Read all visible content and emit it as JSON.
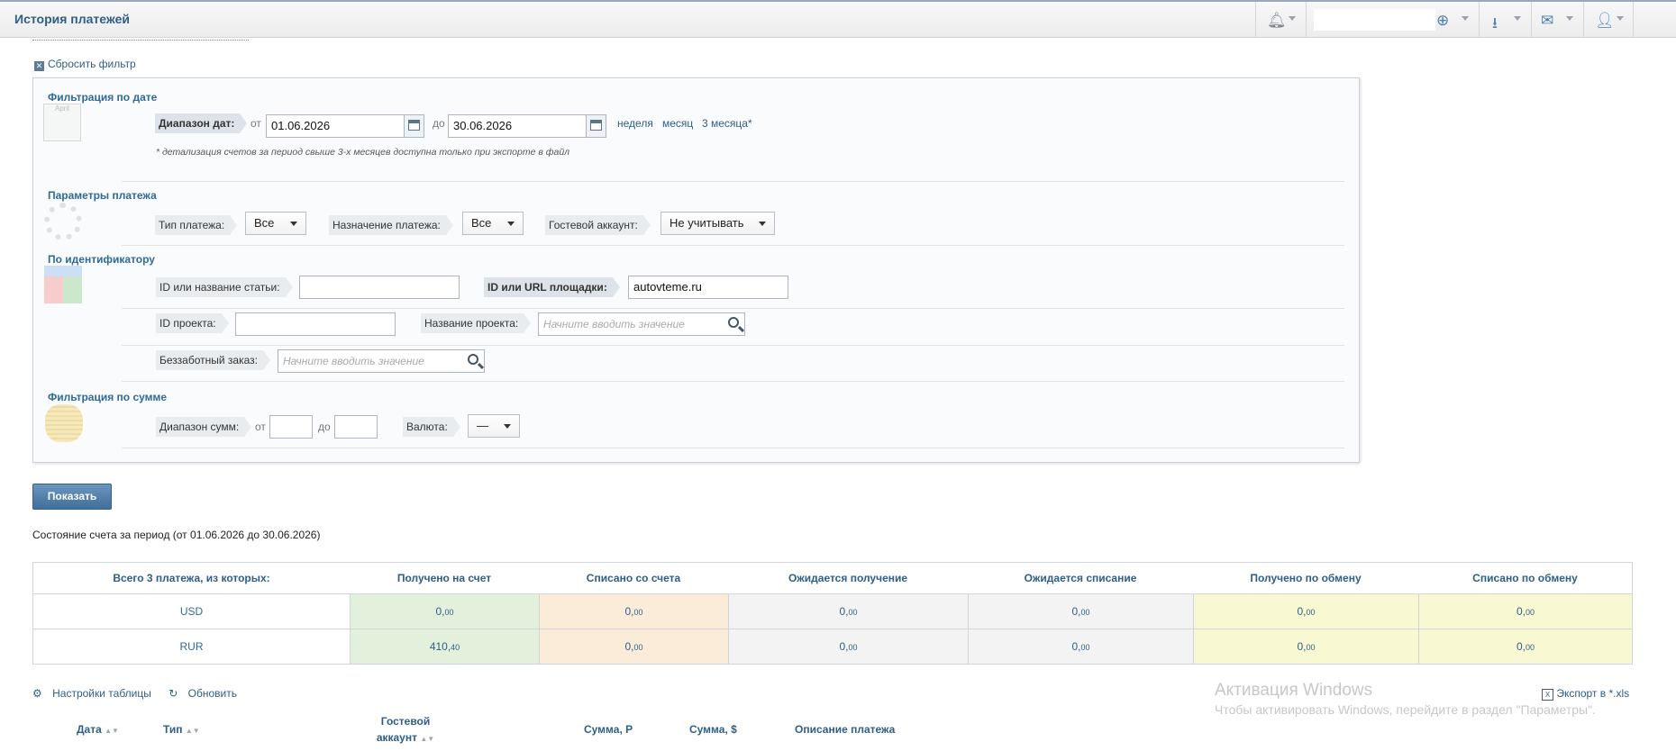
{
  "header": {
    "title": "История платежей"
  },
  "filter": {
    "reset_label": "Сбросить фильтр",
    "date_section": {
      "title": "Фильтрация по дате",
      "range_label": "Диапазон дат:",
      "from_word": "от",
      "from_value": "01.06.2026",
      "to_word": "до",
      "to_value": "30.06.2026",
      "quick_links": [
        "неделя",
        "месяц",
        "3 месяца*"
      ],
      "note": "* детализация счетов за период свыше 3-х месяцев доступна только при экспорте в файл",
      "calendar_img_text": "April"
    },
    "payment_section": {
      "title": "Параметры платежа",
      "type_label": "Тип платежа:",
      "type_value": "Все",
      "purpose_label": "Назначение платежа:",
      "purpose_value": "Все",
      "guest_label": "Гостевой аккаунт:",
      "guest_value": "Не учитывать"
    },
    "id_section": {
      "title": "По идентификатору",
      "article_label": "ID или название статьи:",
      "article_value": "",
      "site_label": "ID или URL площадки:",
      "site_value": "autovteme.ru",
      "project_id_label": "ID проекта:",
      "project_id_value": "",
      "project_name_label": "Название проекта:",
      "project_name_placeholder": "Начните вводить значение",
      "carefree_label": "Беззаботный заказ:",
      "carefree_placeholder": "Начните вводить значение"
    },
    "sum_section": {
      "title": "Фильтрация по сумме",
      "range_label": "Диапазон сумм:",
      "from_word": "от",
      "to_word": "до",
      "currency_label": "Валюта:",
      "currency_value": "—"
    },
    "show_button": "Показать"
  },
  "period_text": "Состояние счета за период (от 01.06.2026 до 30.06.2026)",
  "summary": {
    "headers": [
      "Всего 3 платежа, из которых:",
      "Получено на счет",
      "Списано со счета",
      "Ожидается получение",
      "Ожидается списание",
      "Получено по обмену",
      "Списано по обмену"
    ],
    "rows": [
      {
        "currency": "USD",
        "values": [
          [
            "0,",
            "00"
          ],
          [
            "0,",
            "00"
          ],
          [
            "0,",
            "00"
          ],
          [
            "0,",
            "00"
          ],
          [
            "0,",
            "00"
          ],
          [
            "0,",
            "00"
          ]
        ]
      },
      {
        "currency": "RUR",
        "values": [
          [
            "410,",
            "40"
          ],
          [
            "0,",
            "00"
          ],
          [
            "0,",
            "00"
          ],
          [
            "0,",
            "00"
          ],
          [
            "0,",
            "00"
          ],
          [
            "0,",
            "00"
          ]
        ]
      }
    ],
    "colors": [
      "#ffffff",
      "#e3f1dc",
      "#fbecd9",
      "#f3f3f3",
      "#f3f3f3",
      "#f8f8d2",
      "#f8f8d2"
    ]
  },
  "grid": {
    "settings_label": "Настройки таблицы",
    "refresh_label": "Обновить",
    "export_label": "Экспорт в *.xls",
    "columns": [
      "Дата",
      "Тип",
      "Гостевой аккаунт",
      "Сумма, Р",
      "Сумма, $",
      "Описание платежа"
    ]
  },
  "watermark": {
    "line1": "Активация Windows",
    "line2": "Чтобы активировать Windows, перейдите в раздел \"Параметры\"."
  }
}
